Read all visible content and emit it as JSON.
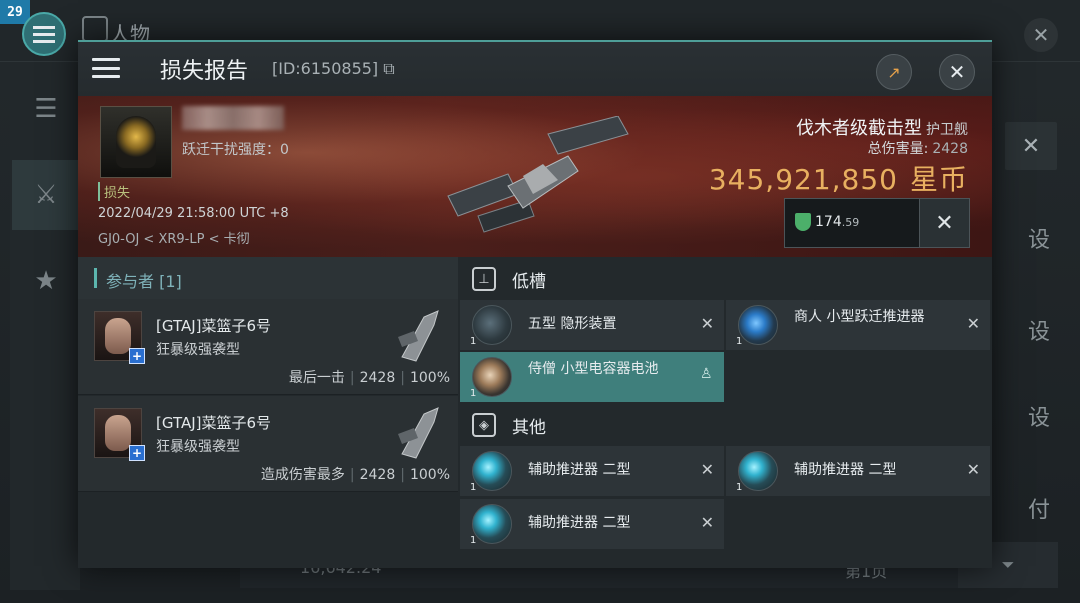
{
  "fps": "29",
  "background": {
    "title": "人物",
    "right_chars": [
      "设",
      "设",
      "设",
      "付"
    ],
    "bottom_value": "16,642.24",
    "bottom_page": "第1页"
  },
  "header": {
    "title": "损失报告",
    "report_id": "[ID:6150855]"
  },
  "victim": {
    "jam_strength_label": "跃迁干扰强度：0",
    "status": "损失",
    "datetime": "2022/04/29 21:58:00 UTC +8",
    "location": "GJ0-OJ < XR9-LP < 卡彻"
  },
  "ship": {
    "name": "伐木者级截击型",
    "class": "护卫舰",
    "total_damage_label": "总伤害量:",
    "total_damage": "2428",
    "isk_value": "345,921,850",
    "isk_unit": "星币",
    "fit_value": "174",
    "fit_value_decimal": ".59"
  },
  "participants": {
    "header": "参与者 [1]",
    "rows": [
      {
        "name": "[GTAJ]菜篮子6号",
        "ship": "狂暴级强袭型",
        "tag": "最后一击",
        "damage": "2428",
        "percent": "100%"
      },
      {
        "name": "[GTAJ]菜篮子6号",
        "ship": "狂暴级强袭型",
        "tag": "造成伤害最多",
        "damage": "2428",
        "percent": "100%"
      }
    ]
  },
  "sections": {
    "low_slot": "低槽",
    "other": "其他"
  },
  "items": {
    "low": [
      {
        "label": "五型 隐形装置",
        "qty": "1",
        "icon": "cloak-icon"
      },
      {
        "label": "商人 小型跃迁推进器",
        "qty": "1",
        "icon": "warp-drive-icon"
      },
      {
        "label": "侍僧 小型电容器电池",
        "qty": "1",
        "icon": "capacitor-battery-icon"
      }
    ],
    "other": [
      {
        "label": "辅助推进器 二型",
        "qty": "1",
        "icon": "afterburner-icon"
      },
      {
        "label": "辅助推进器 二型",
        "qty": "1",
        "icon": "afterburner-icon"
      },
      {
        "label": "辅助推进器 二型",
        "qty": "1",
        "icon": "afterburner-icon"
      }
    ]
  },
  "colors": {
    "accent": "#4e9e98",
    "isk": "#e8b060",
    "highlight_row": "#3f7f7c"
  }
}
